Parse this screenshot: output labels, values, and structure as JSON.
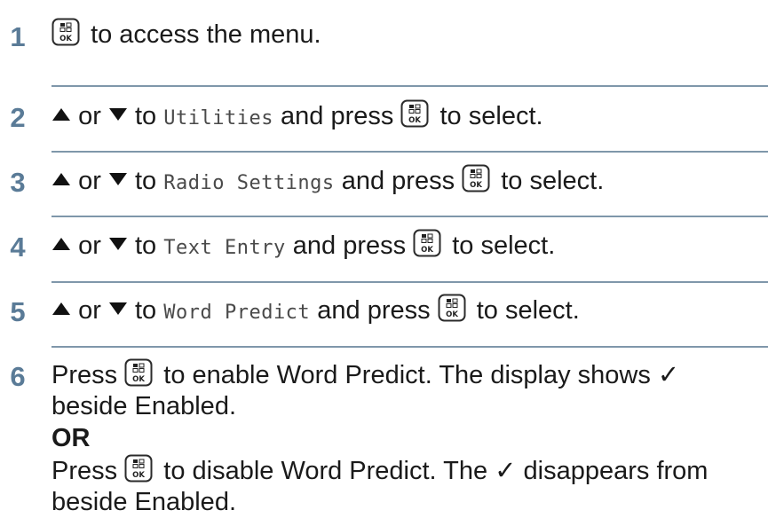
{
  "steps": [
    {
      "number": "1",
      "text": "to access the menu."
    },
    {
      "number": "2",
      "or": "or",
      "to": "to",
      "target": "Utilities",
      "press": "and press",
      "after": "to select."
    },
    {
      "number": "3",
      "or": "or",
      "to": "to",
      "target": "Radio Settings",
      "press": "and press",
      "after": "to select."
    },
    {
      "number": "4",
      "or": "or",
      "to": "to",
      "target": "Text Entry",
      "press": "and press",
      "after": "to select."
    },
    {
      "number": "5",
      "or": "or",
      "to": "to",
      "target": "Word Predict",
      "press": "and press",
      "after": "to select."
    },
    {
      "number": "6",
      "press": "Press",
      "enable_line1": "to enable Word Predict. The display shows ✓",
      "enable_line2": "beside Enabled.",
      "or_label": "OR",
      "disable_line1": "to disable Word Predict. The ✓ disappears from",
      "disable_line2": "beside Enabled."
    }
  ],
  "icons": {
    "ok_key": "menu-ok-key-icon",
    "up": "up-arrow-icon",
    "down": "down-arrow-icon"
  },
  "colors": {
    "step_number": "#5a7b97",
    "divider": "#7f97aa",
    "text": "#1a1a1a"
  }
}
